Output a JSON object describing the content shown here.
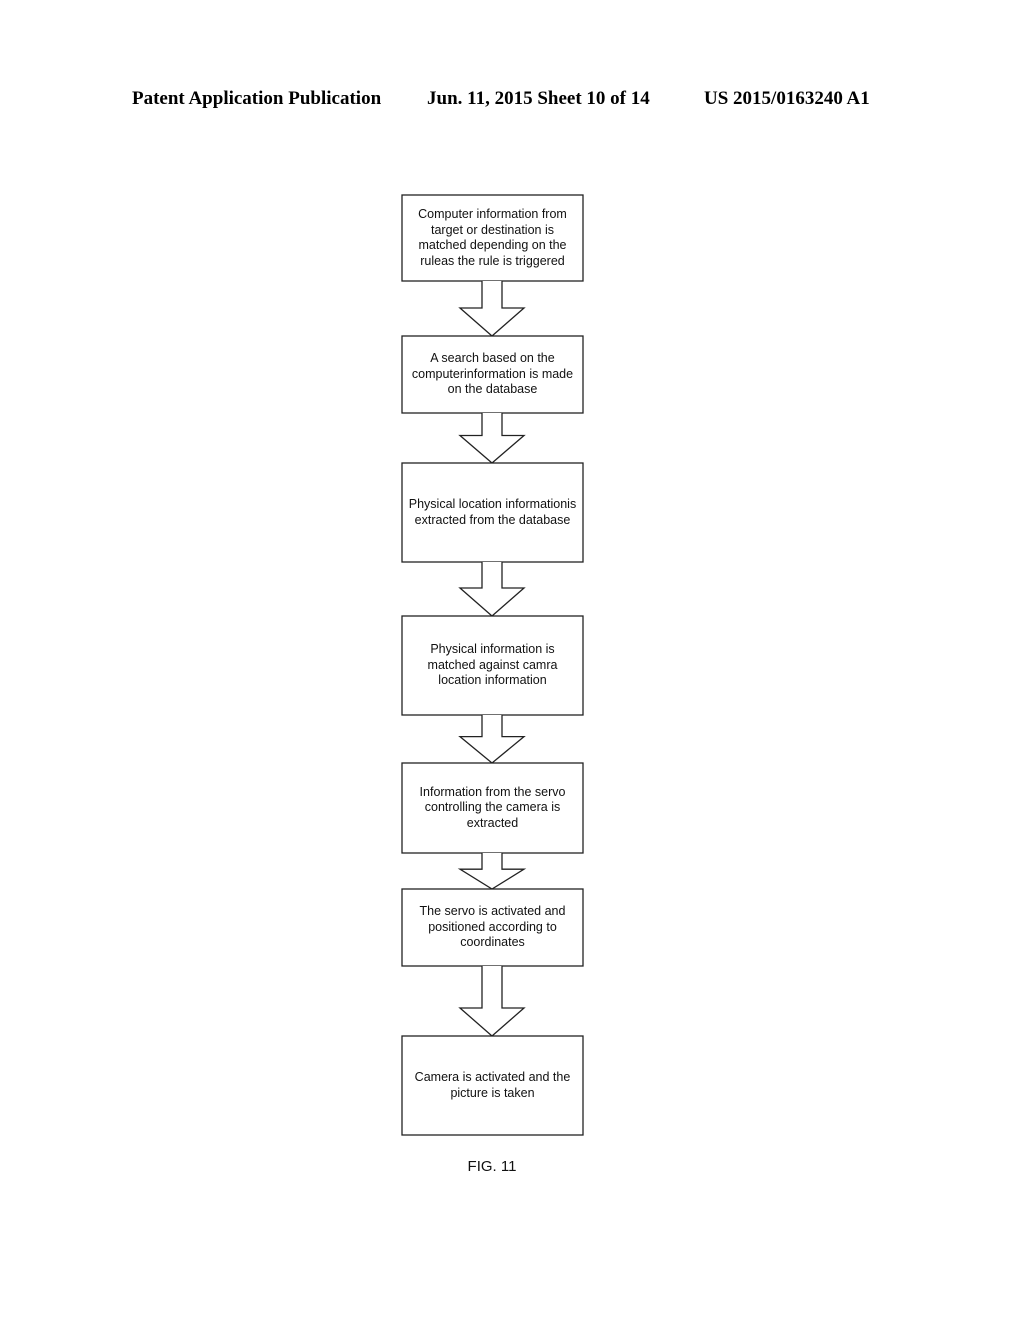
{
  "header": {
    "publication": "Patent Application Publication",
    "date_sheet": "Jun. 11, 2015  Sheet 10 of 14",
    "number": "US 2015/0163240 A1"
  },
  "flowchart": {
    "steps": [
      {
        "text": "Computer information from target or destination is matched depending on the ruleas the rule is triggered"
      },
      {
        "text": "A search based on the computerinformation is made on the database"
      },
      {
        "text": "Physical location informationis extracted from the database"
      },
      {
        "text": "Physical information is matched against camra location information"
      },
      {
        "text": "Information from the servo controlling the camera is extracted"
      },
      {
        "text": "The servo is activated and positioned according to coordinates"
      },
      {
        "text": "Camera is activated and the picture is taken"
      }
    ],
    "connector_icon": "hollow-down-arrow"
  },
  "figure": {
    "label": "FIG. 11"
  }
}
